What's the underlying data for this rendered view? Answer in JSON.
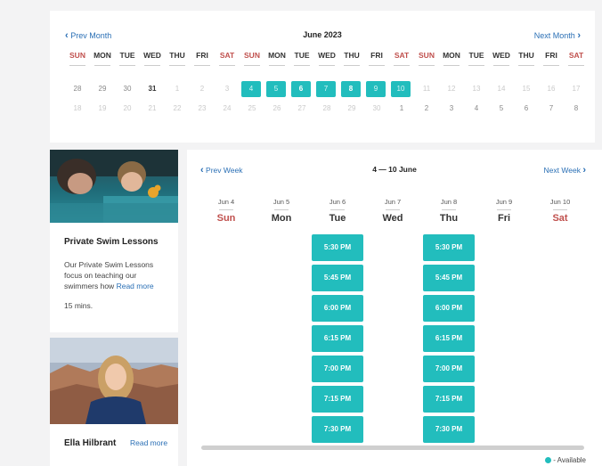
{
  "month": {
    "prev_label": "Prev Month",
    "title": "June 2023",
    "next_label": "Next Month",
    "weekdays": [
      "SUN",
      "MON",
      "TUE",
      "WED",
      "THU",
      "FRI",
      "SAT",
      "SUN",
      "MON",
      "TUE",
      "WED",
      "THU",
      "FRI",
      "SAT",
      "SUN",
      "MON",
      "TUE",
      "WED",
      "THU",
      "FRI",
      "SAT"
    ],
    "row1": [
      "28",
      "29",
      "30",
      "31",
      "1",
      "2",
      "3",
      "4",
      "5",
      "6",
      "7",
      "8",
      "9",
      "10",
      "11",
      "12",
      "13",
      "14",
      "15",
      "16",
      "17"
    ],
    "row2": [
      "18",
      "19",
      "20",
      "21",
      "22",
      "23",
      "24",
      "25",
      "26",
      "27",
      "28",
      "29",
      "30",
      "1",
      "2",
      "3",
      "4",
      "5",
      "6",
      "7",
      "8"
    ]
  },
  "services": [
    {
      "title": "Private Swim Lessons",
      "description": "Our Private Swim Lessons focus on teaching our swimmers how",
      "read_more": "Read more",
      "duration": "15 mins."
    },
    {
      "title": "Ella Hilbrant",
      "read_more": "Read more"
    }
  ],
  "week": {
    "prev_label": "Prev Week",
    "title": "4 — 10 June",
    "next_label": "Next Week",
    "days": [
      {
        "date": "Jun 4",
        "name": "Sun"
      },
      {
        "date": "Jun 5",
        "name": "Mon"
      },
      {
        "date": "Jun 6",
        "name": "Tue"
      },
      {
        "date": "Jun 7",
        "name": "Wed"
      },
      {
        "date": "Jun 8",
        "name": "Thu"
      },
      {
        "date": "Jun 9",
        "name": "Fri"
      },
      {
        "date": "Jun 10",
        "name": "Sat"
      }
    ],
    "tue_slots": [
      "5:30 PM",
      "5:45 PM",
      "6:00 PM",
      "6:15 PM",
      "7:00 PM",
      "7:15 PM",
      "7:30 PM"
    ],
    "thu_slots": [
      "5:30 PM",
      "5:45 PM",
      "6:00 PM",
      "6:15 PM",
      "7:00 PM",
      "7:15 PM",
      "7:30 PM"
    ]
  },
  "legend": {
    "available_label": "- Available"
  },
  "colors": {
    "accent": "#22bdbd",
    "link": "#2a6fb5",
    "weekend": "#c0504d"
  }
}
